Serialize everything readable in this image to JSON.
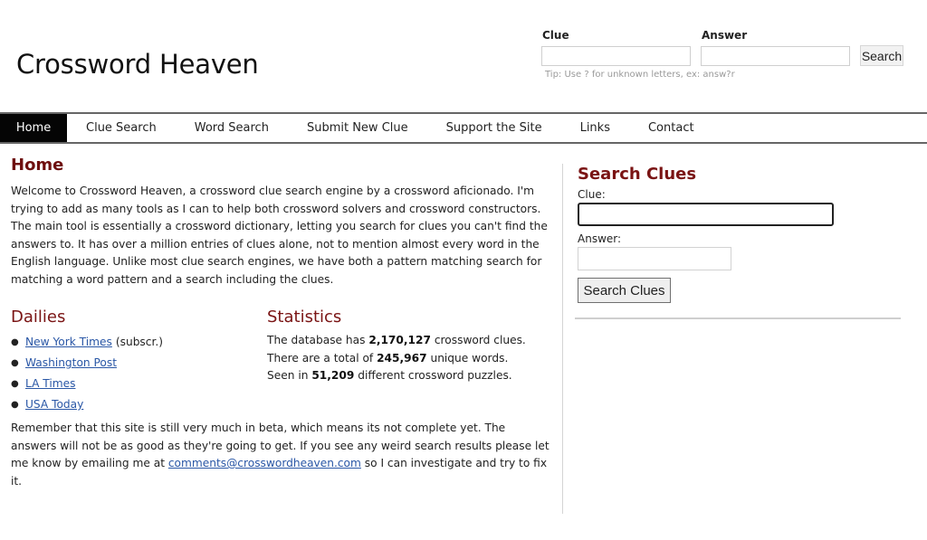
{
  "header": {
    "site_title": "Crossword Heaven",
    "top_search": {
      "clue_label": "Clue",
      "answer_label": "Answer",
      "clue_value": "",
      "answer_value": "",
      "search_button": "Search",
      "tip": "Tip: Use ? for unknown letters, ex: answ?r"
    }
  },
  "nav": {
    "items": [
      {
        "label": "Home",
        "active": true
      },
      {
        "label": "Clue Search"
      },
      {
        "label": "Word Search"
      },
      {
        "label": "Submit New Clue"
      },
      {
        "label": "Support the Site"
      },
      {
        "label": "Links"
      },
      {
        "label": "Contact"
      }
    ]
  },
  "main": {
    "title": "Home",
    "intro": "Welcome to Crossword Heaven, a crossword clue search engine by a crossword aficionado. I'm trying to add as many tools as I can to help both crossword solvers and crossword constructors. The main tool is essentially a crossword dictionary, letting you search for clues you can't find the answers to. It has over a million entries of clues alone, not to mention almost every word in the English language. Unlike most clue search engines, we have both a pattern matching search for matching a word pattern and a search including the clues.",
    "dailies": {
      "title": "Dailies",
      "items": [
        {
          "label": "New York Times",
          "note": "(subscr.)"
        },
        {
          "label": "Washington Post",
          "note": ""
        },
        {
          "label": "LA Times",
          "note": ""
        },
        {
          "label": "USA Today",
          "note": ""
        }
      ]
    },
    "statistics": {
      "title": "Statistics",
      "lines": [
        {
          "before": "The database has ",
          "value": "2,170,127",
          "after": " crossword clues."
        },
        {
          "before": "There are a total of ",
          "value": "245,967",
          "after": " unique words."
        },
        {
          "before": "Seen in ",
          "value": "51,209",
          "after": " different crossword puzzles."
        }
      ]
    },
    "beta_note": {
      "before": "Remember that this site is still very much in beta, which means its not complete yet. The answers will not be as good as they're going to get. If you see any weird search results please let me know by emailing me at ",
      "email": "comments@crosswordheaven.com",
      "after": " so I can investigate and try to fix it."
    }
  },
  "sidebar": {
    "title": "Search Clues",
    "clue_label": "Clue:",
    "clue_value": "",
    "answer_label": "Answer:",
    "answer_value": "",
    "button": "Search Clues"
  },
  "colors": {
    "heading": "#7a1414",
    "link": "#2a57a6",
    "nav_active_bg": "#050505"
  }
}
